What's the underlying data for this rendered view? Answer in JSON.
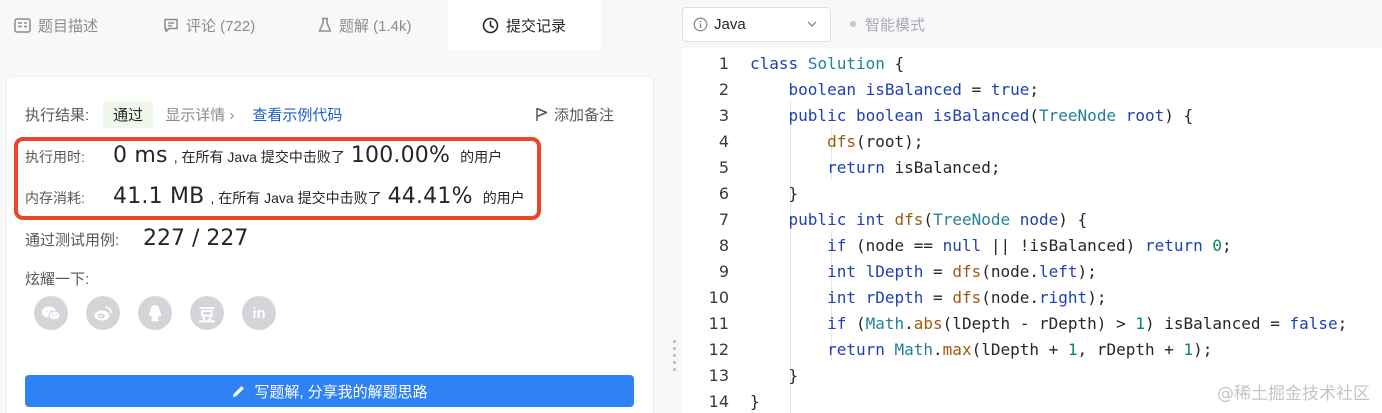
{
  "tabs": [
    {
      "label": "题目描述",
      "icon": "description-icon"
    },
    {
      "label": "评论 (722)",
      "icon": "comment-icon"
    },
    {
      "label": "题解 (1.4k)",
      "icon": "flask-icon"
    },
    {
      "label": "提交记录",
      "icon": "clock-icon",
      "active": true
    }
  ],
  "result": {
    "label": "执行结果:",
    "status": "通过",
    "details_link": "显示详情 ›",
    "example_link": "查看示例代码",
    "add_note": "添加备注"
  },
  "stats": {
    "runtime": {
      "label": "执行用时:",
      "value": "0 ms",
      "text": ", 在所有 Java 提交中击败了",
      "percent": "100.00%",
      "suffix": "的用户"
    },
    "memory": {
      "label": "内存消耗:",
      "value": "41.1 MB",
      "text": ", 在所有 Java 提交中击败了",
      "percent": "44.41%",
      "suffix": "的用户"
    },
    "highlight_color": "#e8472b"
  },
  "tests": {
    "label": "通过测试用例:",
    "value": "227 / 227"
  },
  "share": {
    "label": "炫耀一下:",
    "icons": [
      {
        "name": "wechat-icon",
        "glyph": "✆"
      },
      {
        "name": "weibo-icon",
        "glyph": "◎"
      },
      {
        "name": "qq-icon",
        "glyph": "♙"
      },
      {
        "name": "douban-icon",
        "glyph": "豆"
      },
      {
        "name": "linkedin-icon",
        "glyph": "in"
      }
    ]
  },
  "write_solution": {
    "label": "写题解, 分享我的解题思路",
    "color": "#2f82f1"
  },
  "editor": {
    "language": "Java",
    "smart_mode": "智能模式",
    "lines": [
      "1",
      "2",
      "3",
      "4",
      "5",
      "6",
      "7",
      "8",
      "9",
      "10",
      "11",
      "12",
      "13",
      "14"
    ]
  },
  "watermark": "@稀土掘金技术社区"
}
